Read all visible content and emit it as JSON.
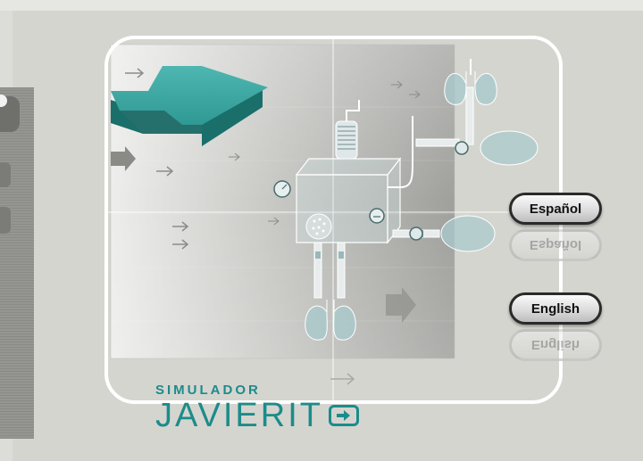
{
  "app": {
    "brand_line1": "SIMULADOR",
    "brand_line2": "JAVIERIT",
    "brand_icon": "arrow-box-icon"
  },
  "language_buttons": {
    "spanish": "Español",
    "english": "English"
  },
  "colors": {
    "accent": "#1c8c8a",
    "background": "#d5d5d0",
    "button_border": "#2a2a2a"
  }
}
